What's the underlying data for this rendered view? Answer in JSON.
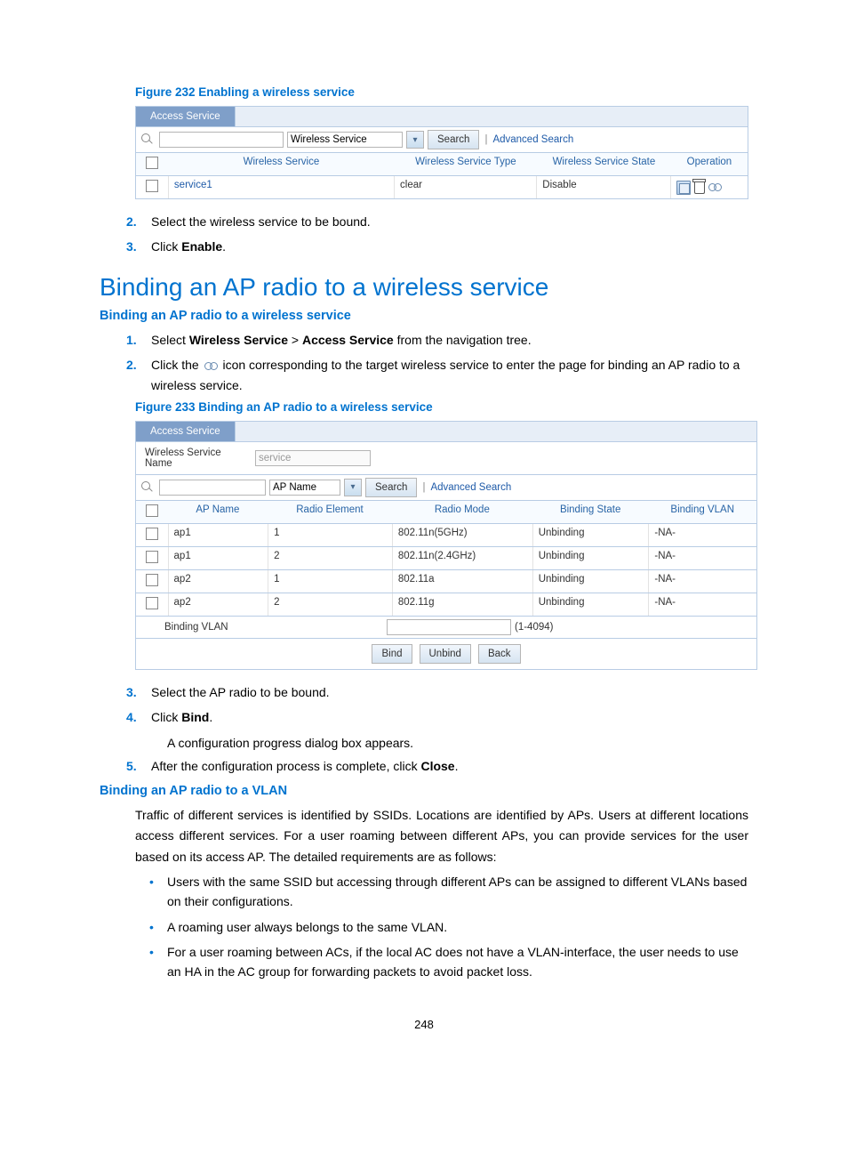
{
  "fig232": {
    "caption": "Figure 232 Enabling a wireless service",
    "tab_label": "Access Service",
    "search_field_value": "Wireless Service",
    "search_btn": "Search",
    "adv_search": "Advanced Search",
    "cols": {
      "c1": "Wireless Service",
      "c2": "Wireless Service Type",
      "c3": "Wireless Service State",
      "c4": "Operation"
    },
    "row": {
      "name": "service1",
      "type": "clear",
      "state": "Disable"
    }
  },
  "steps_a": {
    "s2_num": "2.",
    "s2": "Select the wireless service to be bound.",
    "s3_num": "3.",
    "s3_pre": "Click ",
    "s3_bold": "Enable",
    "s3_post": "."
  },
  "heading_main": "Binding an AP radio to a wireless service",
  "sub_heading1": "Binding an AP radio to a wireless service",
  "steps_b": {
    "s1_num": "1.",
    "s1_pre": "Select ",
    "s1_b1": "Wireless Service",
    "s1_mid": " > ",
    "s1_b2": "Access Service",
    "s1_post": " from the navigation tree.",
    "s2_num": "2.",
    "s2_pre": "Click the ",
    "s2_post": " icon corresponding to the target wireless service to enter the page for binding an AP radio to a wireless service."
  },
  "fig233": {
    "caption": "Figure 233 Binding an AP radio to a wireless service",
    "tab_label": "Access Service",
    "name_label": "Wireless Service Name",
    "name_value": "service",
    "search_dd": "AP Name",
    "search_btn": "Search",
    "adv_search": "Advanced Search",
    "cols": {
      "c1": "AP Name",
      "c2": "Radio Element",
      "c3": "Radio Mode",
      "c4": "Binding State",
      "c5": "Binding VLAN"
    },
    "rows": [
      {
        "ap": "ap1",
        "re": "1",
        "rm": "802.11n(5GHz)",
        "bs": "Unbinding",
        "bv": "-NA-"
      },
      {
        "ap": "ap1",
        "re": "2",
        "rm": "802.11n(2.4GHz)",
        "bs": "Unbinding",
        "bv": "-NA-"
      },
      {
        "ap": "ap2",
        "re": "1",
        "rm": "802.11a",
        "bs": "Unbinding",
        "bv": "-NA-"
      },
      {
        "ap": "ap2",
        "re": "2",
        "rm": "802.11g",
        "bs": "Unbinding",
        "bv": "-NA-"
      }
    ],
    "vlan_label": "Binding VLAN",
    "vlan_range": "(1-4094)",
    "btn_bind": "Bind",
    "btn_unbind": "Unbind",
    "btn_back": "Back"
  },
  "steps_c": {
    "s3_num": "3.",
    "s3": "Select the AP radio to be bound.",
    "s4_num": "4.",
    "s4_pre": "Click ",
    "s4_bold": "Bind",
    "s4_post": ".",
    "s4_sub": "A configuration progress dialog box appears.",
    "s5_num": "5.",
    "s5_pre": "After the configuration process is complete, click ",
    "s5_bold": "Close",
    "s5_post": "."
  },
  "sub_heading2": "Binding an AP radio to a VLAN",
  "para_vlan": "Traffic of different services is identified by SSIDs. Locations are identified by APs. Users at different locations access different services. For a user roaming between different APs, you can provide services for the user based on its access AP. The detailed requirements are as follows:",
  "bullets": {
    "b1": "Users with the same SSID but accessing through different APs can be assigned to different VLANs based on their configurations.",
    "b2": "A roaming user always belongs to the same VLAN.",
    "b3": "For a user roaming between ACs, if the local AC does not have a VLAN-interface, the user needs to use an HA in the AC group for forwarding packets to avoid packet loss."
  },
  "page_number": "248"
}
